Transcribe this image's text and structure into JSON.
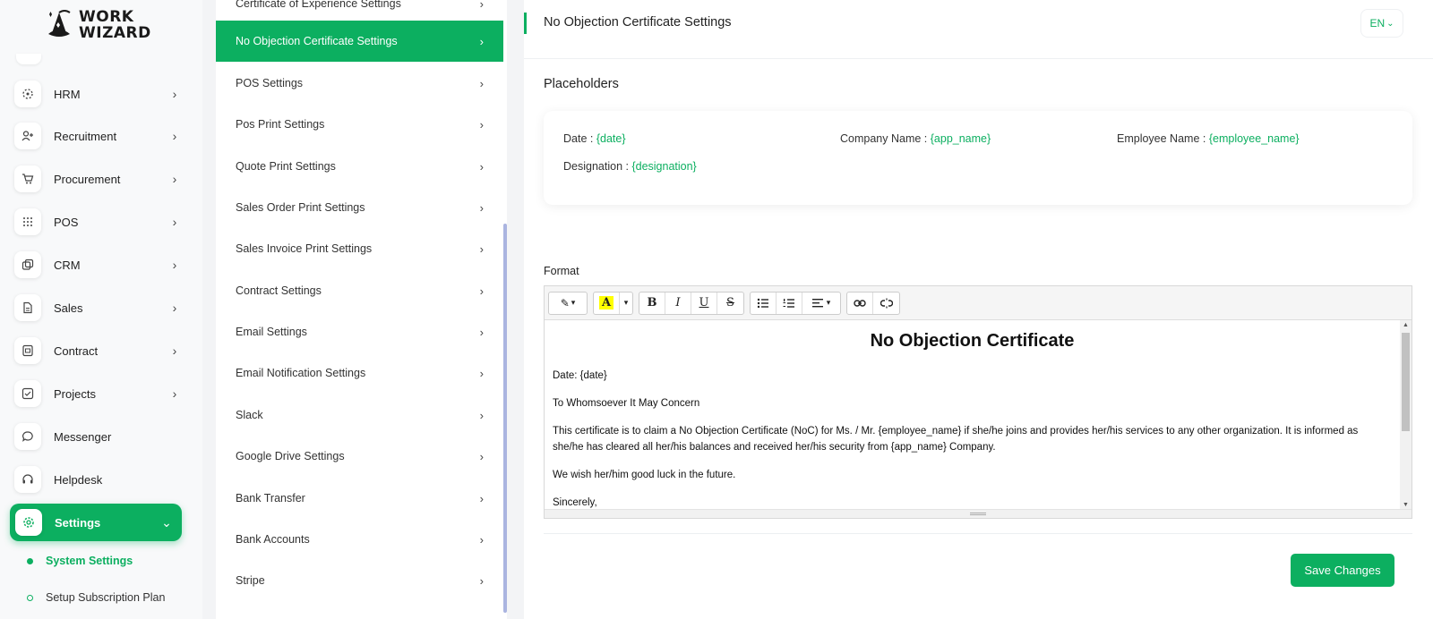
{
  "brand": {
    "line1": "WORK",
    "line2": "WIZARD",
    "icon": "wizard-hat-icon"
  },
  "sidebar": {
    "items": [
      {
        "label": "HRM",
        "icon": "hrm-icon",
        "chevron": "›"
      },
      {
        "label": "Recruitment",
        "icon": "user-plus-icon",
        "chevron": "›"
      },
      {
        "label": "Procurement",
        "icon": "cart-icon",
        "chevron": "›"
      },
      {
        "label": "POS",
        "icon": "grid-icon",
        "chevron": "›"
      },
      {
        "label": "CRM",
        "icon": "layers-icon",
        "chevron": "›"
      },
      {
        "label": "Sales",
        "icon": "file-icon",
        "chevron": "›"
      },
      {
        "label": "Contract",
        "icon": "contract-icon",
        "chevron": "›"
      },
      {
        "label": "Projects",
        "icon": "checkbox-icon",
        "chevron": "›"
      },
      {
        "label": "Messenger",
        "icon": "chat-icon"
      },
      {
        "label": "Helpdesk",
        "icon": "headset-icon"
      },
      {
        "label": "Settings",
        "icon": "gear-icon",
        "chevron": "⌄",
        "active": true
      }
    ],
    "sub_items": [
      {
        "label": "System Settings",
        "active": true
      },
      {
        "label": "Setup Subscription Plan"
      }
    ]
  },
  "settings_menu": {
    "items": [
      {
        "label": "Certificate of Experience Settings"
      },
      {
        "label": "No Objection Certificate Settings",
        "active": true
      },
      {
        "label": "POS Settings"
      },
      {
        "label": "Pos Print Settings"
      },
      {
        "label": "Quote Print Settings"
      },
      {
        "label": "Sales Order Print Settings"
      },
      {
        "label": "Sales Invoice Print Settings"
      },
      {
        "label": "Contract Settings"
      },
      {
        "label": "Email Settings"
      },
      {
        "label": "Email Notification Settings"
      },
      {
        "label": "Slack"
      },
      {
        "label": "Google Drive Settings"
      },
      {
        "label": "Bank Transfer"
      },
      {
        "label": "Bank Accounts"
      },
      {
        "label": "Stripe"
      }
    ],
    "chevron": "›"
  },
  "header": {
    "title": "No Objection Certificate Settings",
    "language": "EN",
    "language_caret": "⌄"
  },
  "placeholders": {
    "title": "Placeholders",
    "items": [
      {
        "label": "Date : ",
        "value": "{date}"
      },
      {
        "label": "Company Name : ",
        "value": "{app_name}"
      },
      {
        "label": "Employee Name : ",
        "value": "{employee_name}"
      },
      {
        "label": "Designation : ",
        "value": "{designation}"
      }
    ]
  },
  "format": {
    "title": "Format",
    "toolbar": {
      "magic": "✎",
      "color": "A",
      "bold": "B",
      "italic": "I",
      "underline": "U",
      "strike": "S",
      "ul": "☰",
      "ol": "≡",
      "align": "≡",
      "link": "🔗",
      "unlink": "⛓",
      "caret": "▾"
    },
    "content": {
      "heading": "No Objection Certificate",
      "paragraphs": [
        "Date: {date}",
        "To Whomsoever It May Concern",
        "This certificate is to claim a No Objection Certificate (NoC) for Ms. / Mr. {employee_name} if she/he joins and provides her/his services to any other organization. It is informed as she/he has cleared all her/his balances and received her/his security from {app_name} Company.",
        "We wish her/him good luck in the future.",
        "Sincerely,"
      ]
    }
  },
  "actions": {
    "save_label": "Save Changes"
  },
  "colors": {
    "accent": "#0caf60",
    "scrollbar": "#aab4e0"
  }
}
